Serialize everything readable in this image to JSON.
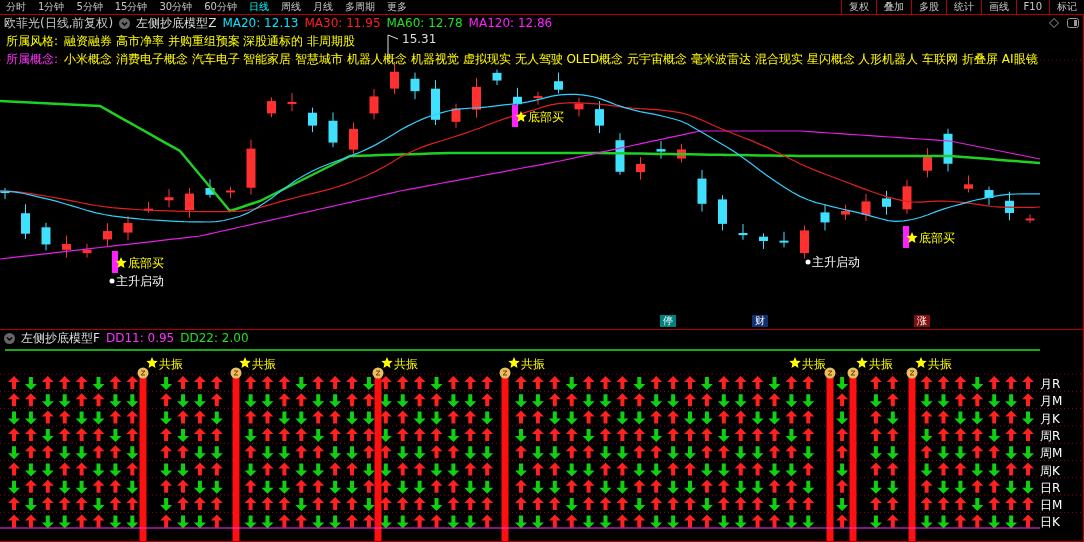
{
  "toolbar": {
    "periods": [
      {
        "label": "分时",
        "selected": false
      },
      {
        "label": "1分钟",
        "selected": false
      },
      {
        "label": "5分钟",
        "selected": false
      },
      {
        "label": "15分钟",
        "selected": false
      },
      {
        "label": "30分钟",
        "selected": false
      },
      {
        "label": "60分钟",
        "selected": false
      },
      {
        "label": "日线",
        "selected": true
      },
      {
        "label": "周线",
        "selected": false
      },
      {
        "label": "月线",
        "selected": false
      },
      {
        "label": "多周期",
        "selected": false
      },
      {
        "label": "更多",
        "selected": false
      }
    ],
    "tools": [
      "复权",
      "叠加",
      "多股",
      "统计",
      "画线",
      "F10",
      "标记"
    ]
  },
  "main_chart": {
    "stock": "欧菲光(日线,前复权)",
    "indicator": "左侧抄底模型Z",
    "ma": [
      {
        "label": "MA20: 12.13",
        "color": "#00e5ff"
      },
      {
        "label": "MA30: 11.95",
        "color": "#ff2020"
      },
      {
        "label": "MA60: 12.78",
        "color": "#20e020"
      },
      {
        "label": "MA120: 12.86",
        "color": "#ff20ff"
      }
    ],
    "style_label": "所属风格:",
    "styles": "融资融券 高市净率 并购重组预案 深股通标的 非周期股",
    "concept_label": "所属概念:",
    "concepts": "小米概念 消费电子概念 汽车电子 智能家居 智慧城市 机器人概念 机器视觉 虚拟现实 无人驾驶 OLED概念 元宇宙概念 毫米波雷达 混合现实 星闪概念 人形机器人 车联网 折叠屏 AI眼镜",
    "annotations": [
      {
        "kind": "high",
        "text": "15.31"
      },
      {
        "kind": "buy",
        "text": "底部买"
      },
      {
        "kind": "start",
        "text": "主升启动"
      },
      {
        "kind": "buy",
        "text": "底部买"
      },
      {
        "kind": "start",
        "text": "主升启动"
      },
      {
        "kind": "buy",
        "text": "底部买"
      }
    ],
    "badges": [
      {
        "text": "停",
        "color": "#008080"
      },
      {
        "text": "财",
        "color": "#103070"
      },
      {
        "text": "涨",
        "color": "#801010"
      }
    ]
  },
  "sub_chart": {
    "indicator": "左侧抄底模型F",
    "values": [
      {
        "label": "DD11: 0.95",
        "color": "#ff30ff"
      },
      {
        "label": "DD22: 2.00",
        "color": "#20e020"
      }
    ],
    "resonance": [
      "共振",
      "共振",
      "共振",
      "共振",
      "共振",
      "共振",
      "共振"
    ],
    "row_labels": [
      "月R",
      "月M",
      "月K",
      "周R",
      "周M",
      "周K",
      "日R",
      "日M",
      "日K"
    ]
  }
}
